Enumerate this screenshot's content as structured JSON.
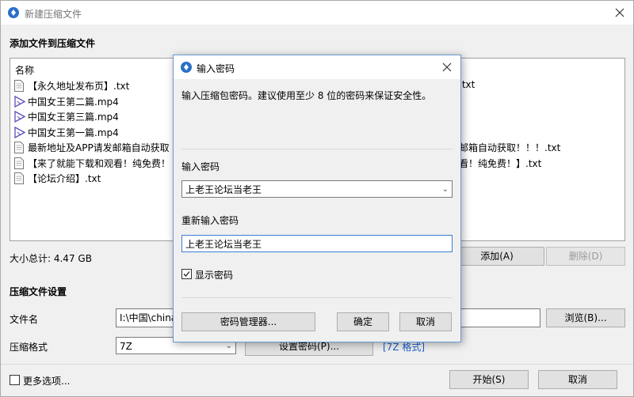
{
  "main": {
    "title": "新建压缩文件",
    "add_files_heading": "添加文件到压缩文件",
    "column_name": "名称",
    "files": [
      {
        "name": "【永久地址发布页】.txt",
        "type": "txt"
      },
      {
        "name": "中国女王第二篇.mp4",
        "type": "mp4"
      },
      {
        "name": "中国女王第三篇.mp4",
        "type": "mp4"
      },
      {
        "name": "中国女王第一篇.mp4",
        "type": "mp4"
      },
      {
        "name": "最新地址及APP请发邮箱自动获取",
        "type": "txt"
      },
      {
        "name": "【来了就能下载和观看！纯免费！",
        "type": "txt"
      },
      {
        "name": "【论坛介绍】.txt",
        "type": "txt"
      }
    ],
    "files_hidden_fragments": [
      ".txt",
      "邮箱自动获取！！！.txt",
      "看！纯免费！】.txt"
    ],
    "total_size": "大小总计: 4.47 GB",
    "add_button": "添加(A)",
    "delete_button": "删除(D)",
    "settings_heading": "压缩文件设置",
    "filename_label": "文件名",
    "filename_value": "I:\\中国\\china",
    "browse_button": "浏览(B)...",
    "format_label": "压缩格式",
    "format_value": "7Z",
    "set_password_button": "设置密码(P)...",
    "format_link": "[7Z 格式]",
    "more_options": "更多选项...",
    "start_button": "开始(S)",
    "cancel_button": "取消"
  },
  "dialog": {
    "title": "输入密码",
    "instruction": "输入压缩包密码。建议使用至少 8 位的密码来保证安全性。",
    "password_label": "输入密码",
    "password_value": "上老王论坛当老王",
    "repeat_label": "重新输入密码",
    "repeat_value": "上老王论坛当老王",
    "show_password": "显示密码",
    "show_password_checked": true,
    "manager_button": "密码管理器...",
    "ok_button": "确定",
    "cancel_button": "取消"
  },
  "colors": {
    "accent": "#2b6fc9",
    "link": "#1a5fcf",
    "focus_border": "#3c7fd6"
  }
}
